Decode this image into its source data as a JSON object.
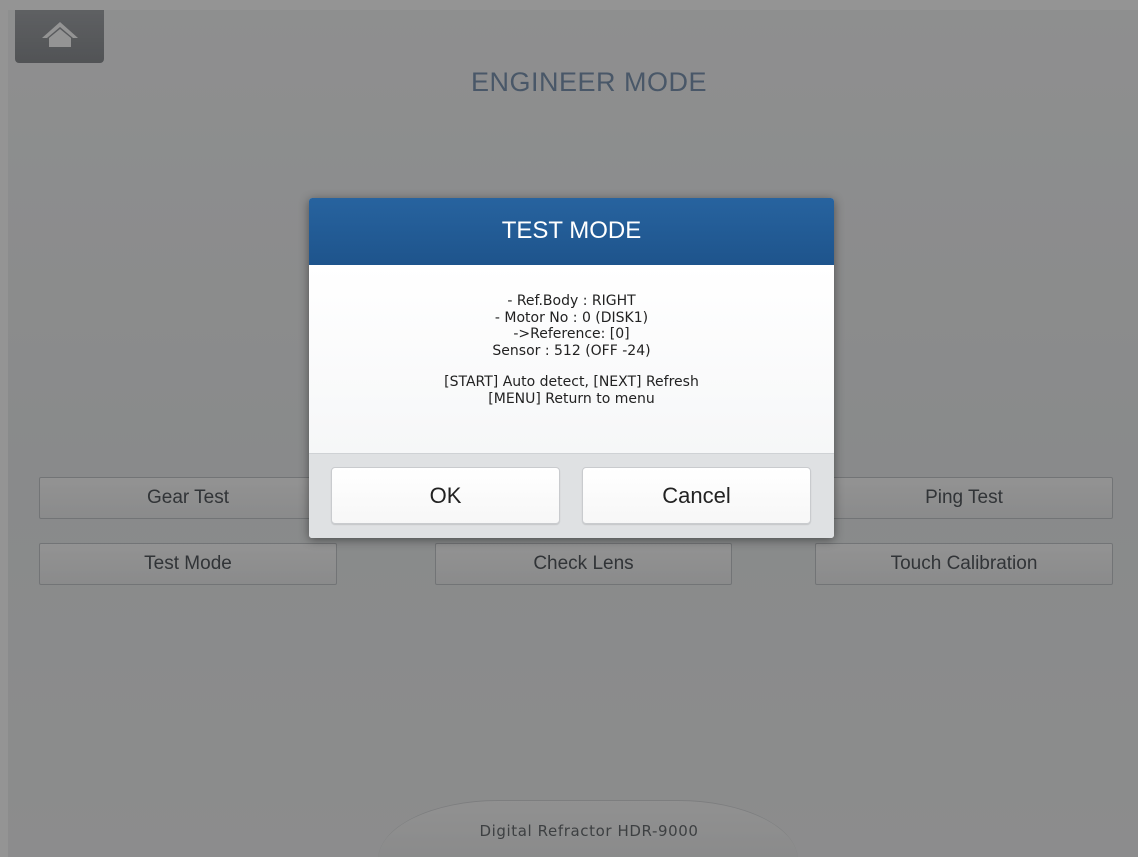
{
  "app": {
    "title": "ENGINEER MODE",
    "footer": "Digital Refractor HDR-9000"
  },
  "menu": {
    "buttons": [
      {
        "label": "Gear Test"
      },
      {
        "label": "Ping Test"
      },
      {
        "label": "Test Mode"
      },
      {
        "label": "Check Lens"
      },
      {
        "label": "Touch Calibration"
      }
    ]
  },
  "dialog": {
    "title": "TEST MODE",
    "lines": [
      "- Ref.Body : RIGHT",
      "- Motor No : 0 (DISK1)",
      "->Reference: [0]",
      "Sensor : 512 (OFF -24)",
      "[START] Auto detect, [NEXT] Refresh",
      "[MENU] Return to menu"
    ],
    "ok_label": "OK",
    "cancel_label": "Cancel"
  },
  "icons": {
    "home": "home-icon"
  },
  "colors": {
    "dialog_header": "#1e548c",
    "title_text": "#7f97b3"
  }
}
